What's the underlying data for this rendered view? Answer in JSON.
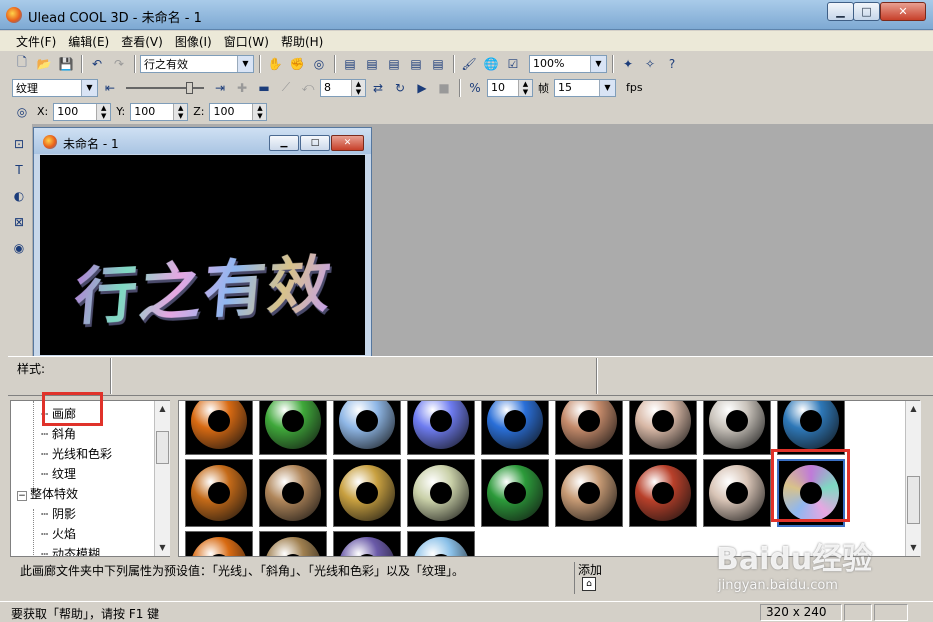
{
  "window": {
    "title": "Ulead COOL 3D - 未命名 - 1"
  },
  "menu": [
    "文件(F)",
    "编辑(E)",
    "查看(V)",
    "图像(I)",
    "窗口(W)",
    "帮助(H)"
  ],
  "toolbar1": {
    "text_combo": "行之有效",
    "zoom_combo": "100%"
  },
  "toolbar2": {
    "attr_combo": "纹理",
    "spin1": "8",
    "spin2": "10",
    "frame_label": "帧",
    "frame_combo": "15",
    "fps_label": "fps"
  },
  "toolbar3": {
    "x_label": "X:",
    "x_value": "100",
    "y_label": "Y:",
    "y_value": "100",
    "z_label": "Z:",
    "z_value": "100"
  },
  "document": {
    "title": "未命名 - 1",
    "canvas_text": "行之有效"
  },
  "style_panel": {
    "label": "样式:"
  },
  "tree": {
    "items": [
      {
        "label": "画廊"
      },
      {
        "label": "斜角"
      },
      {
        "label": "光线和色彩"
      },
      {
        "label": "纹理"
      },
      {
        "label": "整体特效",
        "expander": "−"
      },
      {
        "label": "阴影"
      },
      {
        "label": "火焰"
      },
      {
        "label": "动态模糊"
      }
    ]
  },
  "gallery": {
    "selected_index": 17,
    "colors": [
      "#d86a12",
      "#3fa83a",
      "#8fb7e6",
      "#6e7cf0",
      "#2a6fd8",
      "#c48a6a",
      "#d8b8a6",
      "#c9c3bb",
      "#2e78b8",
      "#c46a18",
      "#b0865a",
      "#c8a040",
      "#c9d0a8",
      "#2c9a3a",
      "#c69a74",
      "#b8402a",
      "#d8c4b6",
      "#c07ad8",
      "#d86a12",
      "#a08050",
      "#6a5aa8",
      "#8ac0e8"
    ]
  },
  "description": {
    "text": "此画廊文件夹中下列属性为预设值：「光线」、「斜角」、「光线和色彩」以及「纹理」。",
    "add_label": "添加"
  },
  "status": {
    "help_text": "要获取「帮助」，请按 F1 键",
    "canvas_size": "320 x 240"
  },
  "watermark": {
    "text": "Baidu经验",
    "url": "jingyan.baidu.com"
  }
}
